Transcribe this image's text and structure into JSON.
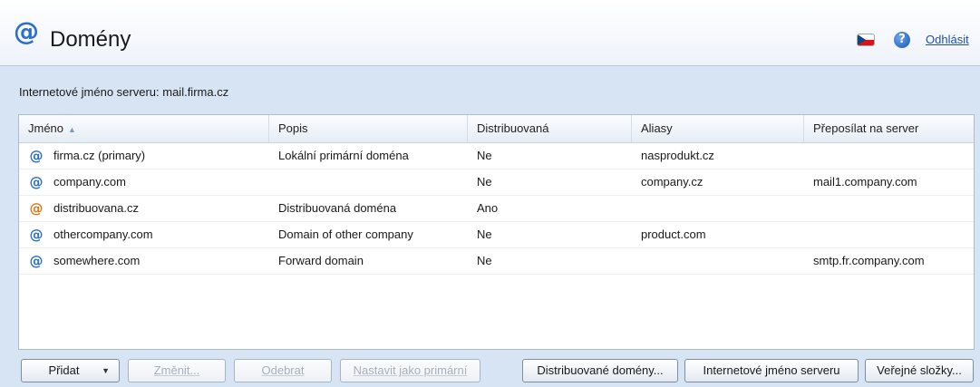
{
  "header": {
    "title": "Domény",
    "logout_label": "Odhlásit",
    "help_symbol": "?",
    "logo_symbol": "@"
  },
  "server_line": "Internetové jméno serveru: mail.firma.cz",
  "table": {
    "columns": [
      "Jméno",
      "Popis",
      "Distribuovaná",
      "Aliasy",
      "Přeposílat na server"
    ],
    "sort_column": "Jméno",
    "sort_direction": "ascending",
    "rows": [
      {
        "icon": "local-domain-icon",
        "icon_color": "#2b6fcc",
        "name": "firma.cz (primary)",
        "description": "Lokální primární doména",
        "distributed": "Ne",
        "aliases": "nasprodukt.cz",
        "forward": ""
      },
      {
        "icon": "local-domain-icon",
        "icon_color": "#2b6fcc",
        "name": "company.com",
        "description": "",
        "distributed": "Ne",
        "aliases": "company.cz",
        "forward": "mail1.company.com"
      },
      {
        "icon": "distributed-domain-icon",
        "icon_color": "#e07a1f",
        "name": "distribuovana.cz",
        "description": "Distribuovaná doména",
        "distributed": "Ano",
        "aliases": "",
        "forward": ""
      },
      {
        "icon": "local-domain-icon",
        "icon_color": "#2b6fcc",
        "name": "othercompany.com",
        "description": "Domain of other company",
        "distributed": "Ne",
        "aliases": "product.com",
        "forward": ""
      },
      {
        "icon": "local-domain-icon",
        "icon_color": "#2b6fcc",
        "name": "somewhere.com",
        "description": "Forward domain",
        "distributed": "Ne",
        "aliases": "",
        "forward": "smtp.fr.company.com"
      }
    ]
  },
  "buttons": {
    "add": "Přidat",
    "edit": "Změnit...",
    "remove": "Odebrat",
    "set_primary": "Nastavit jako primární",
    "distributed_domains": "Distribuované domény...",
    "server_hostname": "Internetové jméno serveru",
    "public_folders": "Veřejné složky..."
  }
}
